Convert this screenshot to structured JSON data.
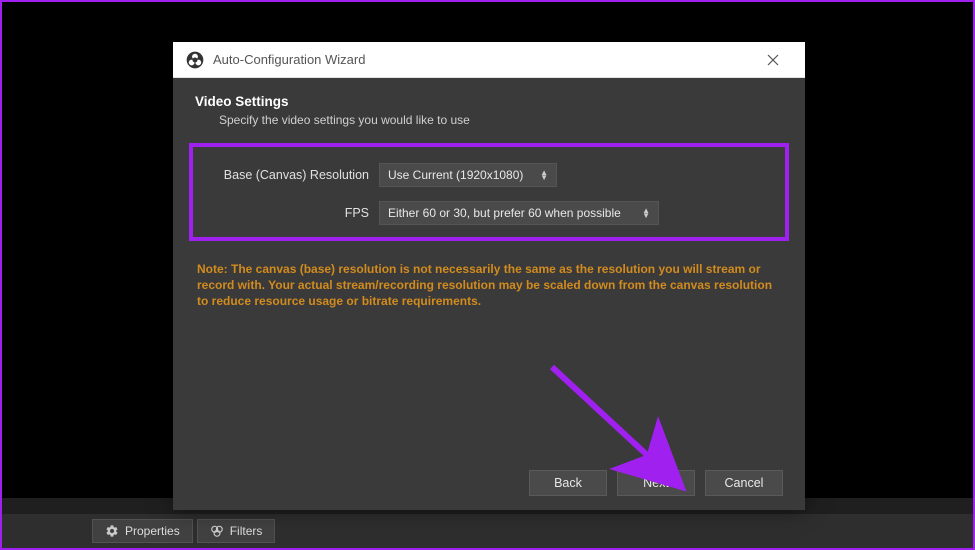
{
  "window": {
    "title": "Auto-Configuration Wizard"
  },
  "dialog": {
    "heading": "Video Settings",
    "subheading": "Specify the video settings you would like to use",
    "fields": {
      "resolution": {
        "label": "Base (Canvas) Resolution",
        "value": "Use Current (1920x1080)"
      },
      "fps": {
        "label": "FPS",
        "value": "Either 60 or 30, but prefer 60 when possible"
      }
    },
    "note": "Note: The canvas (base) resolution is not necessarily the same as the resolution you will stream or record with. Your actual stream/recording resolution may be scaled down from the canvas resolution to reduce resource usage or bitrate requirements.",
    "buttons": {
      "back": "Back",
      "next": "Next",
      "cancel": "Cancel"
    }
  },
  "toolbar": {
    "properties": "Properties",
    "filters": "Filters"
  },
  "colors": {
    "highlight": "#a020f0",
    "note": "#d28b1e"
  }
}
